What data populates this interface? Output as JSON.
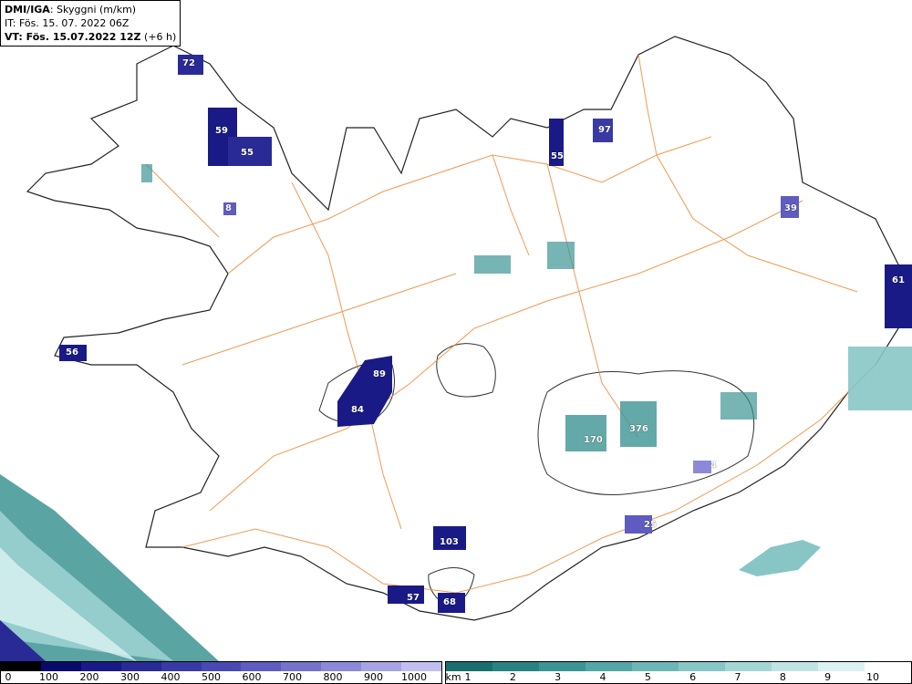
{
  "header": {
    "model": "DMI/IGA",
    "field": ": Skyggni (m/km)",
    "it": "IT: Fös. 15. 07. 2022 06Z",
    "vt_bold": "VT: Fös. 15.07.2022 12Z",
    "vt_lead": " (+6 h)"
  },
  "legend_visibility": {
    "ticks": [
      "0",
      "100",
      "200",
      "300",
      "400",
      "500",
      "600",
      "700",
      "800",
      "900",
      "1000"
    ],
    "colors": [
      "#000000",
      "#0a0a6a",
      "#1a1a86",
      "#2a2a96",
      "#3a3aa4",
      "#4a48b2",
      "#5e5cc0",
      "#7472cc",
      "#8c8ad8",
      "#a6a4e4",
      "#c0bff0"
    ]
  },
  "legend_ceiling": {
    "unit": "km",
    "ticks": [
      "1",
      "2",
      "3",
      "4",
      "5",
      "6",
      "7",
      "8",
      "9",
      "10"
    ],
    "colors": [
      "#1c6e6e",
      "#2a8282",
      "#3d9494",
      "#55a6a6",
      "#6db6b6",
      "#88c6c6",
      "#a4d6d6",
      "#c0e4e4",
      "#dcf2f2",
      "#ffffff"
    ]
  },
  "map_labels": [
    {
      "text": "72"
    },
    {
      "text": "59"
    },
    {
      "text": "55"
    },
    {
      "text": "8"
    },
    {
      "text": "97"
    },
    {
      "text": "55"
    },
    {
      "text": "39"
    },
    {
      "text": "61"
    },
    {
      "text": "56"
    },
    {
      "text": "89"
    },
    {
      "text": "84"
    },
    {
      "text": "376"
    },
    {
      "text": "170"
    },
    {
      "text": "4"
    },
    {
      "text": "25"
    },
    {
      "text": "103"
    },
    {
      "text": "57"
    },
    {
      "text": "68"
    }
  ]
}
